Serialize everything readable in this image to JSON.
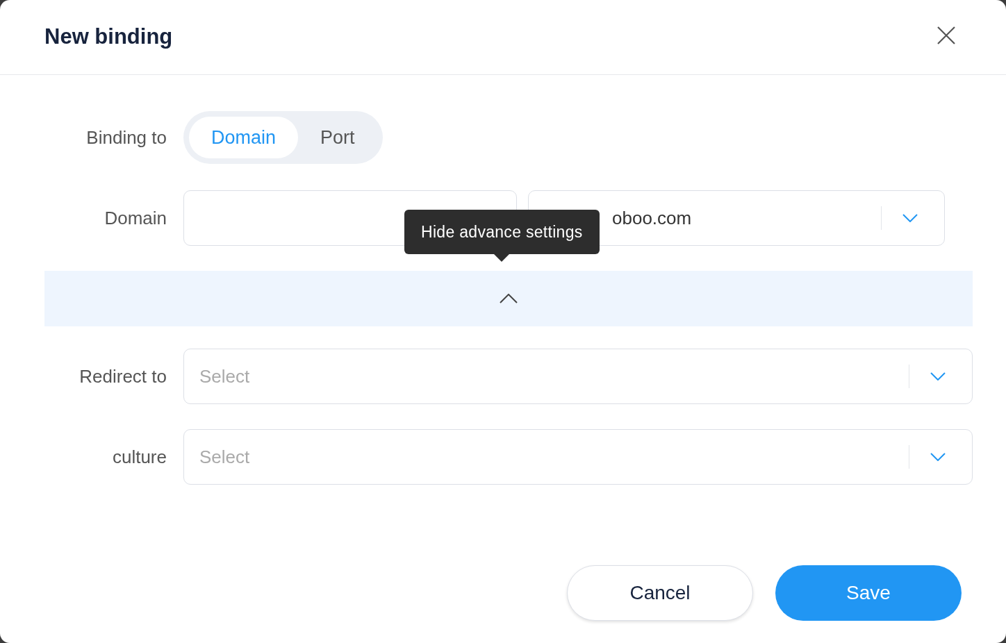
{
  "dialog": {
    "title": "New binding"
  },
  "binding_to": {
    "label": "Binding to",
    "options": [
      {
        "label": "Domain",
        "selected": true
      },
      {
        "label": "Port",
        "selected": false
      }
    ]
  },
  "domain": {
    "label": "Domain",
    "suffix_value": "oboo.com"
  },
  "tooltip": "Hide advance settings",
  "advanced": {
    "expanded": true
  },
  "fields": [
    {
      "label": "Redirect to",
      "placeholder": "Select"
    },
    {
      "label": "culture",
      "placeholder": "Select"
    }
  ],
  "buttons": [
    {
      "label": "Cancel",
      "kind": "secondary"
    },
    {
      "label": "Save",
      "kind": "primary"
    }
  ]
}
